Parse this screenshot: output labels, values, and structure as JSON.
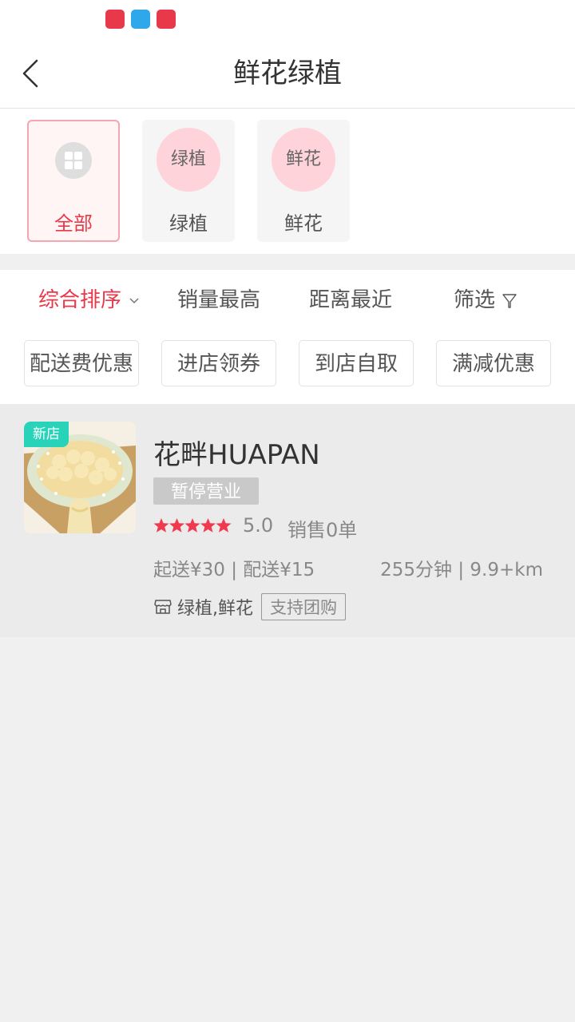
{
  "status_bar": {
    "icons": [
      "app-icon-red",
      "app-icon-blue",
      "app-icon-red-pinduoduo"
    ]
  },
  "header": {
    "title": "鲜花绿植"
  },
  "categories": [
    {
      "label": "全部",
      "icon": "grid-icon",
      "active": true
    },
    {
      "label": "绿植",
      "circle_text": "绿植",
      "active": false
    },
    {
      "label": "鲜花",
      "circle_text": "鲜花",
      "active": false
    }
  ],
  "sort": {
    "items": [
      {
        "label": "综合排序",
        "active": true
      },
      {
        "label": "销量最高",
        "active": false
      },
      {
        "label": "距离最近",
        "active": false
      },
      {
        "label": "筛选",
        "active": false
      }
    ]
  },
  "filters": {
    "chips": [
      "配送费优惠",
      "进店领券",
      "到店自取",
      "满减优惠"
    ]
  },
  "stores": [
    {
      "badge": "新店",
      "name": "花畔HUAPAN",
      "status": "暂停营业",
      "stars": 5,
      "rating": "5.0",
      "sales": "销售0单",
      "delivery": "起送¥30 | 配送¥15",
      "time_distance": "255分钟 | 9.9+km",
      "categories": "绿植,鲜花",
      "tag": "支持团购"
    }
  ],
  "colors": {
    "accent": "#e8384a",
    "new_badge": "#29d3b9",
    "category_circle": "#ffd3da",
    "closed_badge": "#c9c9c9",
    "page_bg": "#f0f0f0"
  }
}
